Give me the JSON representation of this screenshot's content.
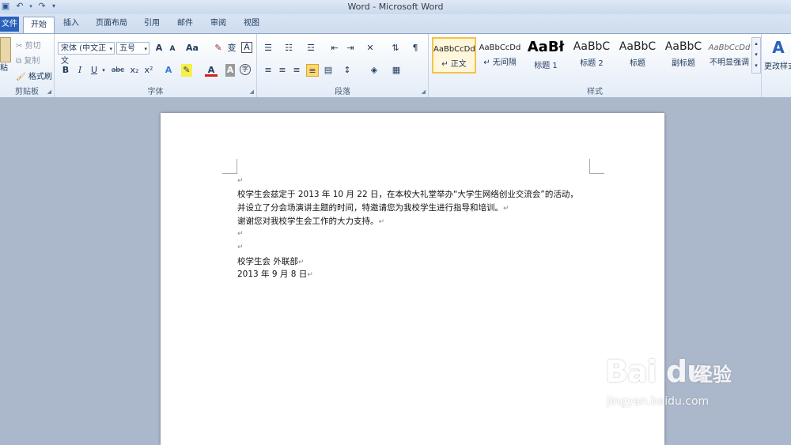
{
  "window": {
    "title": "Word - Microsoft Word"
  },
  "tabs": [
    "文件",
    "开始",
    "插入",
    "页面布局",
    "引用",
    "邮件",
    "审阅",
    "视图"
  ],
  "clipboard": {
    "group_label": "剪贴板",
    "paste_label": "粘",
    "cut_label": "剪切",
    "copy_label": "复制",
    "format_painter_label": "格式刷"
  },
  "font": {
    "group_label": "字体",
    "font_name": "宋体 (中文正文",
    "font_size": "五号",
    "case_label": "Aa",
    "bold": "B",
    "italic": "I",
    "underline": "U",
    "strike": "abc",
    "sub": "x₂",
    "sup": "x²",
    "grow": "A",
    "shrink": "A",
    "pinyin": "变",
    "border_char": "A",
    "font_color_label": "A",
    "shade_label": "A",
    "enclose_label": "字"
  },
  "paragraph": {
    "group_label": "段落"
  },
  "styles": {
    "group_label": "样式",
    "items": [
      {
        "sample": "AaBbCcDd",
        "name": "正文",
        "prefix": "↵"
      },
      {
        "sample": "AaBbCcDd",
        "name": "无间隔",
        "prefix": "↵"
      },
      {
        "sample": "AaBł",
        "name": "标题 1",
        "prefix": ""
      },
      {
        "sample": "AaBbC",
        "name": "标题 2",
        "prefix": ""
      },
      {
        "sample": "AaBbC",
        "name": "标题",
        "prefix": ""
      },
      {
        "sample": "AaBbC",
        "name": "副标题",
        "prefix": ""
      },
      {
        "sample": "AaBbCcDd",
        "name": "不明显强调",
        "prefix": ""
      }
    ],
    "change_styles_label": "更改样式"
  },
  "document": {
    "lines": [
      "",
      "校学生会兹定于 2013 年 10 月 22 日，在本校大礼堂举办“大学生网络创业交流会”的活动，",
      "并设立了分会场演讲主题的时间，特邀请您为我校学生进行指导和培训。",
      "谢谢您对我校学生会工作的大力支持。",
      "",
      "",
      "校学生会  外联部",
      "2013 年 9 月 8 日"
    ],
    "paragraph_mark": "↵"
  },
  "watermark": {
    "brand": "Bai du",
    "cn": "经验",
    "url": "jingyan.baidu.com"
  }
}
